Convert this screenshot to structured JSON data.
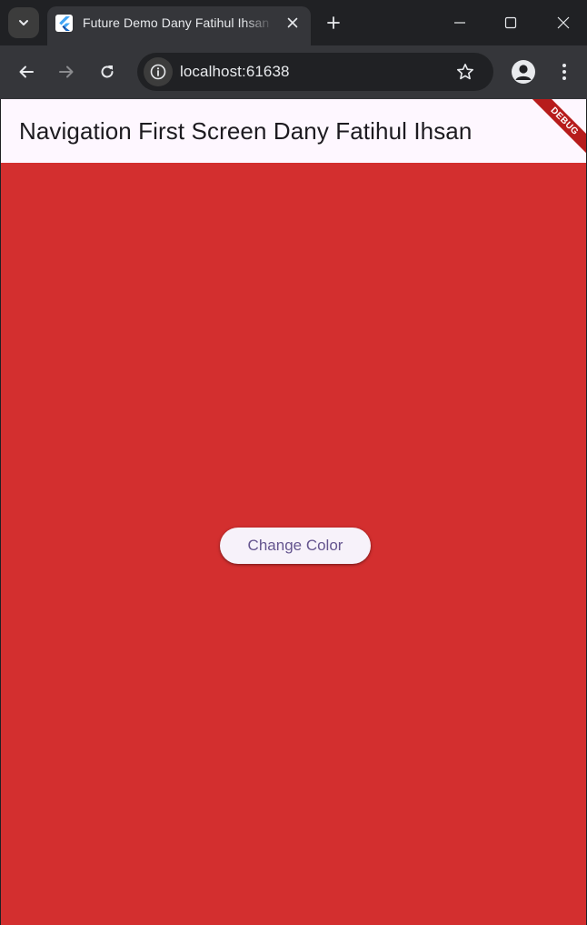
{
  "browser": {
    "tab": {
      "title": "Future Demo Dany Fatihul Ihsan",
      "favicon": "flutter-logo-icon"
    },
    "address_bar": {
      "url": "localhost:61638"
    },
    "icons": {
      "tab_search": "chevron-down-icon",
      "close_tab": "close-icon",
      "new_tab": "plus-icon",
      "minimize": "minimize-icon",
      "maximize": "maximize-icon",
      "close_window": "close-icon",
      "back": "arrow-left-icon",
      "forward": "arrow-right-icon",
      "reload": "reload-icon",
      "site_info": "info-icon",
      "bookmark": "star-icon",
      "profile": "person-icon",
      "menu": "more-vert-icon"
    }
  },
  "app": {
    "appbar_title": "Navigation First Screen Dany Fatihul Ihsan",
    "debug_banner": "DEBUG",
    "button_label": "Change Color",
    "background_color": "#d32f2f",
    "appbar_color": "#fef7ff",
    "button_text_color": "#65558f"
  }
}
